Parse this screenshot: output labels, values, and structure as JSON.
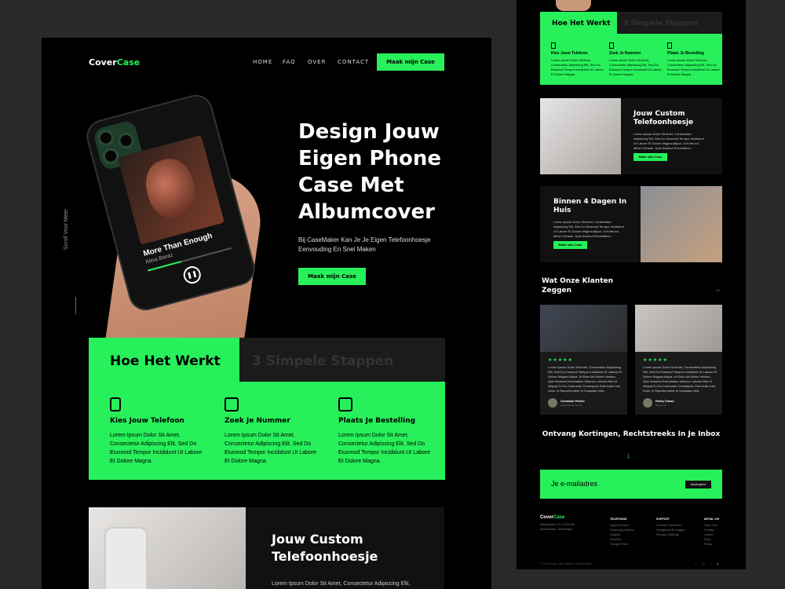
{
  "brand": {
    "part1": "Cover",
    "part2": "Case"
  },
  "nav": {
    "home": "HOME",
    "faq": "FAQ",
    "over": "OVER",
    "contact": "CONTACT",
    "cta": "Maak mijn Case"
  },
  "hero": {
    "title": "Design Jouw Eigen Phone Case Met Albumcover",
    "subtitle": "Bij CaseMaker Kan Je Je Eigen Telefoonhoesje Eenvouding En Snel Maken",
    "cta": "Maak mijn Case",
    "scroll": "Scroll Voor Meer"
  },
  "player": {
    "song": "More Than Enough",
    "artist": "Alina Baraz"
  },
  "how": {
    "tab": "Hoe Het Werkt",
    "tab2": "3 Simpele Stappen",
    "steps": [
      {
        "title": "Kies Jouw Telefoon",
        "text": "Lorem Ipsum Dolor Sit Amet, Consectetur Adipiscing Elit, Sed Do Eiusmod Tempor Incididunt Ut Labore Et Dolore Magna.",
        "icon": "phone-icon"
      },
      {
        "title": "Zoek Je Nummer",
        "text": "Lorem Ipsum Dolor Sit Amet, Consectetur Adipiscing Elit, Sed Do Eiusmod Tempor Incididunt Ut Labore Et Dolore Magna.",
        "icon": "music-search-icon"
      },
      {
        "title": "Plaats Je Bestelling",
        "text": "Lorem Ipsum Dolor Sit Amet, Consectetur Adipiscing Elit, Sed Do Eiusmod Tempor Incididunt Ut Labore Et Dolore Magna.",
        "icon": "box-icon"
      }
    ]
  },
  "custom": {
    "title": "Jouw Custom Telefoonhoesje",
    "text": "Lorem Ipsum Dolor Sit Amet, Consectetur Adipiscing Elit, Sed Do Eiusmod Tempor"
  },
  "right": {
    "how_tab": "Hoe Het Werkt",
    "how_tab2": "3 Simpele Stappen",
    "steps": [
      {
        "title": "Kies Jouw Telefoon",
        "text": "Lorem Ipsum Dolor Sit Amet, Consectetur Adipiscing Elit, Sed Do Eiusmod Tempor Incididunt Ut Labore Et Dolore Magna."
      },
      {
        "title": "Zoek Je Nummer",
        "text": "Lorem Ipsum Dolor Sit Amet, Consectetur Adipiscing Elit, Sed Do Eiusmod Tempor Incididunt Ut Labore Et Dolore Magna."
      },
      {
        "title": "Plaats Je Bestelling",
        "text": "Lorem Ipsum Dolor Sit Amet, Consectetur Adipiscing Elit, Sed Do Eiusmod Tempor Incididunt Ut Labore Et Dolore Magna."
      }
    ],
    "custom_title": "Jouw Custom Telefoonhoesje",
    "custom_text": "Lorem Ipsum Dolor Sit Amet, Consectetur Adipiscing Elit, Sed Do Eiusmod Tempor Incididunt Ut Labore Et Dolore Magna Aliqua. Ut Enim Ad Minim Veniam, Quis Nostrud Exercitation.",
    "custom_btn": "Maak mijn Case",
    "days_title": "Binnen 4 Dagen In Huis",
    "days_text": "Lorem Ipsum Dolor Sit Amet, Consectetur Adipiscing Elit, Sed Do Eiusmod Tempor Incididunt Ut Labore Et Dolore Magna Aliqua. Ut Enim Ad Minim Veniam, Quis Nostrud Exercitation.",
    "days_btn": "Maak mijn Case",
    "testimonials_title": "Wat Onze Klanten Zeggen",
    "reviews": [
      {
        "stars": "★★★★★",
        "text": "Lorem Ipsum Dolor Sit Amet, Consectetur Adipiscing Elit, Sed Do Eiusmod Tempor Incididunt Ut Labore Et Dolore Magna Aliqua. Ut Enim Ad Minim Veniam, Quis Nostrud Exercitation Ullamco Laboris Nisi Ut Aliquip Ex Ea Commodo Consequat. Duis Aute Irure Dolor In Reprehenderit In Voluptate Velit.",
        "name": "Christian Parker",
        "role": "Apple iPhone 11 Pro"
      },
      {
        "stars": "★★★★★",
        "text": "Lorem Ipsum Dolor Sit Amet, Consectetur Adipiscing Elit, Sed Do Eiusmod Tempor Incididunt Ut Labore Et Dolore Magna Aliqua. Ut Enim Ad Minim Veniam, Quis Nostrud Exercitation Ullamco Laboris Nisi Ut Aliquip Ex Ea Commodo Consequat. Duis Aute Irure Dolor In Reprehenderit In Voluptate Velit.",
        "name": "Reilly Chase",
        "role": "iPhone 11"
      }
    ],
    "newsletter": "Ontvang Kortingen, Rechtstreeks In Je Inbox",
    "email_placeholder": "Je e-mailadres",
    "email_btn": "Inschrijven",
    "footer": {
      "address": "Straatnaam 12, 1234 AB Amsterdam, Nederland",
      "col1_title": "TELEFOONS",
      "col1": "Apple iPhone\nSamsung Galaxy\nHuawei\nOnePlus\nGoogle Pixel",
      "col2_title": "SUPPORT",
      "col2": "Contact Opnemen\nVeelgestelde Vragen\nPrivacy Settings",
      "col3_title": "DETAIL V/H",
      "col3": "Over Ons\nPrivacy\nCases\nFAQ\nPolicy",
      "copy": "© Cover Case. Alle rechten voorbehouden",
      "social": "f ◎ t ▶"
    }
  },
  "colors": {
    "accent": "#27f05a",
    "bg": "#000000",
    "outer": "#2a282b"
  }
}
